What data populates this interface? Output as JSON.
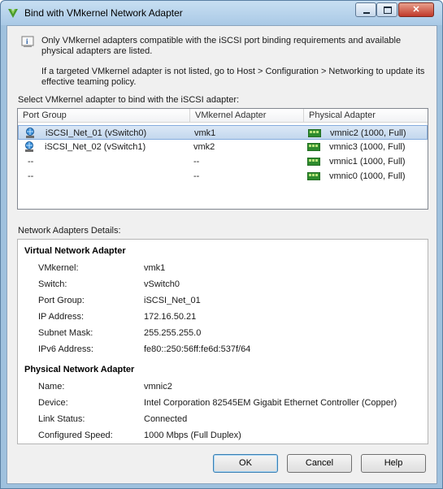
{
  "window": {
    "title": "Bind with VMkernel Network Adapter"
  },
  "info": {
    "line1": "Only VMkernel adapters compatible with the iSCSI port binding requirements and available physical adapters are listed.",
    "line2": "If a targeted VMkernel adapter is not listed, go to Host > Configuration > Networking to update its effective teaming policy."
  },
  "select_label": "Select VMkernel adapter to bind with the iSCSI adapter:",
  "grid": {
    "columns": [
      "Port Group",
      "VMkernel Adapter",
      "Physical Adapter"
    ],
    "rows": [
      {
        "port_group": "iSCSI_Net_01 (vSwitch0)",
        "vmk": "vmk1",
        "physical": "vmnic2 (1000, Full)",
        "selected": true
      },
      {
        "port_group": "iSCSI_Net_02 (vSwitch1)",
        "vmk": "vmk2",
        "physical": "vmnic3 (1000, Full)",
        "selected": false
      },
      {
        "port_group": "--",
        "vmk": "--",
        "physical": "vmnic1 (1000, Full)",
        "selected": false
      },
      {
        "port_group": "--",
        "vmk": "--",
        "physical": "vmnic0 (1000, Full)",
        "selected": false
      }
    ]
  },
  "details_label": "Network Adapters Details:",
  "virtual": {
    "title": "Virtual Network Adapter",
    "fields": [
      {
        "key": "VMkernel:",
        "value": "vmk1"
      },
      {
        "key": "Switch:",
        "value": "vSwitch0"
      },
      {
        "key": "Port Group:",
        "value": "iSCSI_Net_01"
      },
      {
        "key": "IP Address:",
        "value": "172.16.50.21"
      },
      {
        "key": "Subnet Mask:",
        "value": "255.255.255.0"
      },
      {
        "key": "IPv6 Address:",
        "value": "fe80::250:56ff:fe6d:537f/64"
      }
    ]
  },
  "physical": {
    "title": "Physical Network Adapter",
    "fields": [
      {
        "key": "Name:",
        "value": "vmnic2"
      },
      {
        "key": "Device:",
        "value": "Intel Corporation 82545EM Gigabit Ethernet Controller (Copper)"
      },
      {
        "key": "Link Status:",
        "value": "Connected"
      },
      {
        "key": "Configured Speed:",
        "value": "1000 Mbps (Full Duplex)"
      }
    ]
  },
  "buttons": {
    "ok": "OK",
    "cancel": "Cancel",
    "help": "Help"
  },
  "icons": {
    "app": "vsphere-logo-icon",
    "info": "info-icon",
    "port_group": "network-port-icon",
    "nic": "physical-nic-icon"
  },
  "colors": {
    "selection": "#c3d7ee",
    "nic_green": "#2e8b2e"
  }
}
